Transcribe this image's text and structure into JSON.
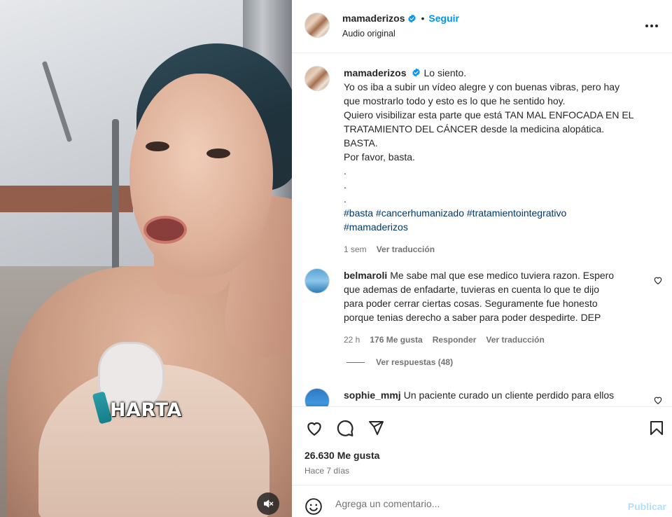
{
  "media": {
    "caption": "HARTA",
    "mute_icon": "speaker-muted-icon"
  },
  "header": {
    "username": "mamaderizos",
    "separator": "•",
    "follow_label": "Seguir",
    "audio": "Audio original",
    "more_icon": "more-horizontal-icon"
  },
  "post_caption": {
    "username": "mamaderizos",
    "lines": [
      "Lo siento.",
      "Yo os iba a subir un vídeo alegre y con buenas vibras, pero hay",
      "que mostrarlo todo y esto es lo que he sentido hoy.",
      "Quiero visibilizar esta parte que está TAN MAL ENFOCADA EN EL",
      "TRATAMIENTO DEL CÁNCER desde la medicina alopática.",
      "BASTA.",
      "Por favor, basta.",
      ".",
      ".",
      "."
    ],
    "hashtags_line1": "#basta #cancerhumanizado #tratamientointegrativo",
    "hashtags_line2": "#mamaderizos",
    "time": "1 sem",
    "translate": "Ver traducción"
  },
  "comments": [
    {
      "username": "belmaroli",
      "lines": [
        "Me sabe mal que ese medico tuviera razon. Espero",
        "que ademas de enfadarte, tuvieras en cuenta lo que te dijo",
        "para poder cerrar ciertas cosas. Seguramente fue honesto",
        "porque tenias derecho a saber para poder despedirte. DEP"
      ],
      "time": "22 h",
      "likes": "176 Me gusta",
      "reply": "Responder",
      "translate": "Ver traducción"
    },
    {
      "username": "sophie_mmj",
      "lines": [
        "Un paciente curado un cliente perdido para ellos"
      ]
    }
  ],
  "view_replies": "Ver respuestas (48)",
  "actions": {
    "like_icon": "heart-icon",
    "comment_icon": "comment-icon",
    "share_icon": "send-icon",
    "save_icon": "bookmark-icon",
    "likes": "26.630 Me gusta",
    "date": "Hace 7 días"
  },
  "comment_box": {
    "placeholder": "Agrega un comentario...",
    "publish": "Publicar",
    "emoji_icon": "emoji-icon"
  },
  "colors": {
    "accent": "#0095f6",
    "hashtag": "#00376b",
    "muted": "#737373",
    "publish_disabled": "#b2dffc"
  }
}
